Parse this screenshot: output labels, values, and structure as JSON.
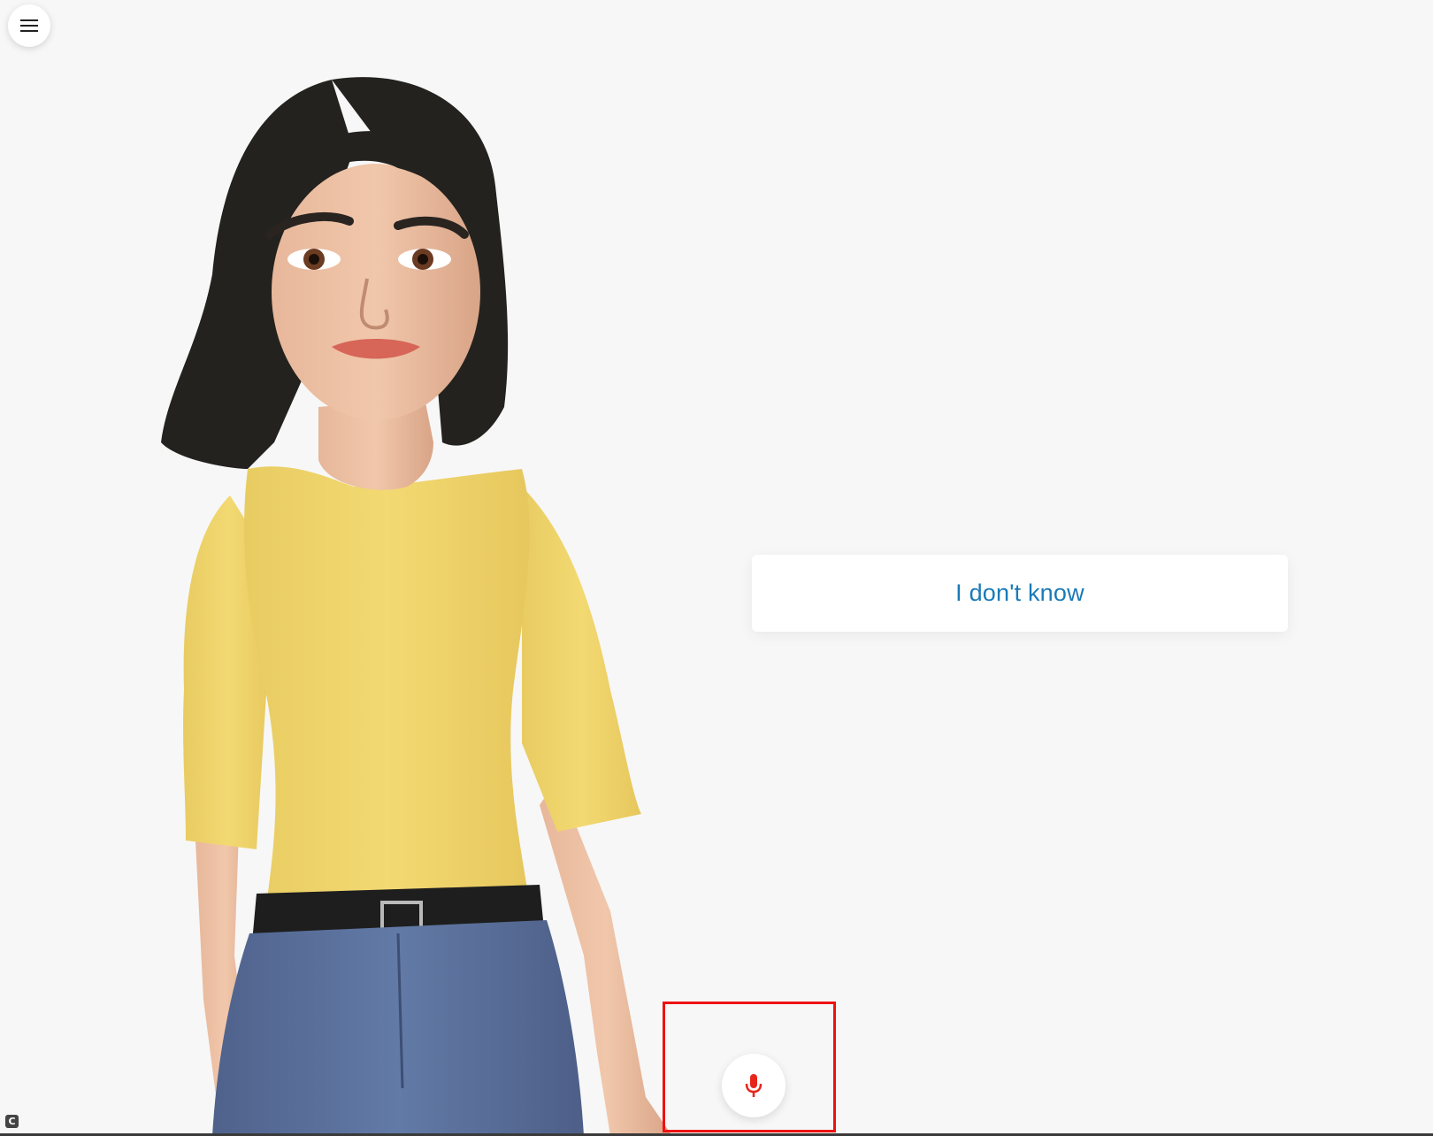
{
  "menu": {
    "icon": "hamburger-menu-icon"
  },
  "response": {
    "text": "I don't know"
  },
  "mic": {
    "icon": "microphone-icon",
    "color": "#e8251b"
  },
  "corner_badge": {
    "text": "C"
  },
  "colors": {
    "background": "#f7f7f7",
    "response_text": "#1a7ab8",
    "highlight": "#ee1111",
    "shirt": "#f2d76b",
    "jeans": "#5a6d96",
    "hair": "#23221f"
  }
}
